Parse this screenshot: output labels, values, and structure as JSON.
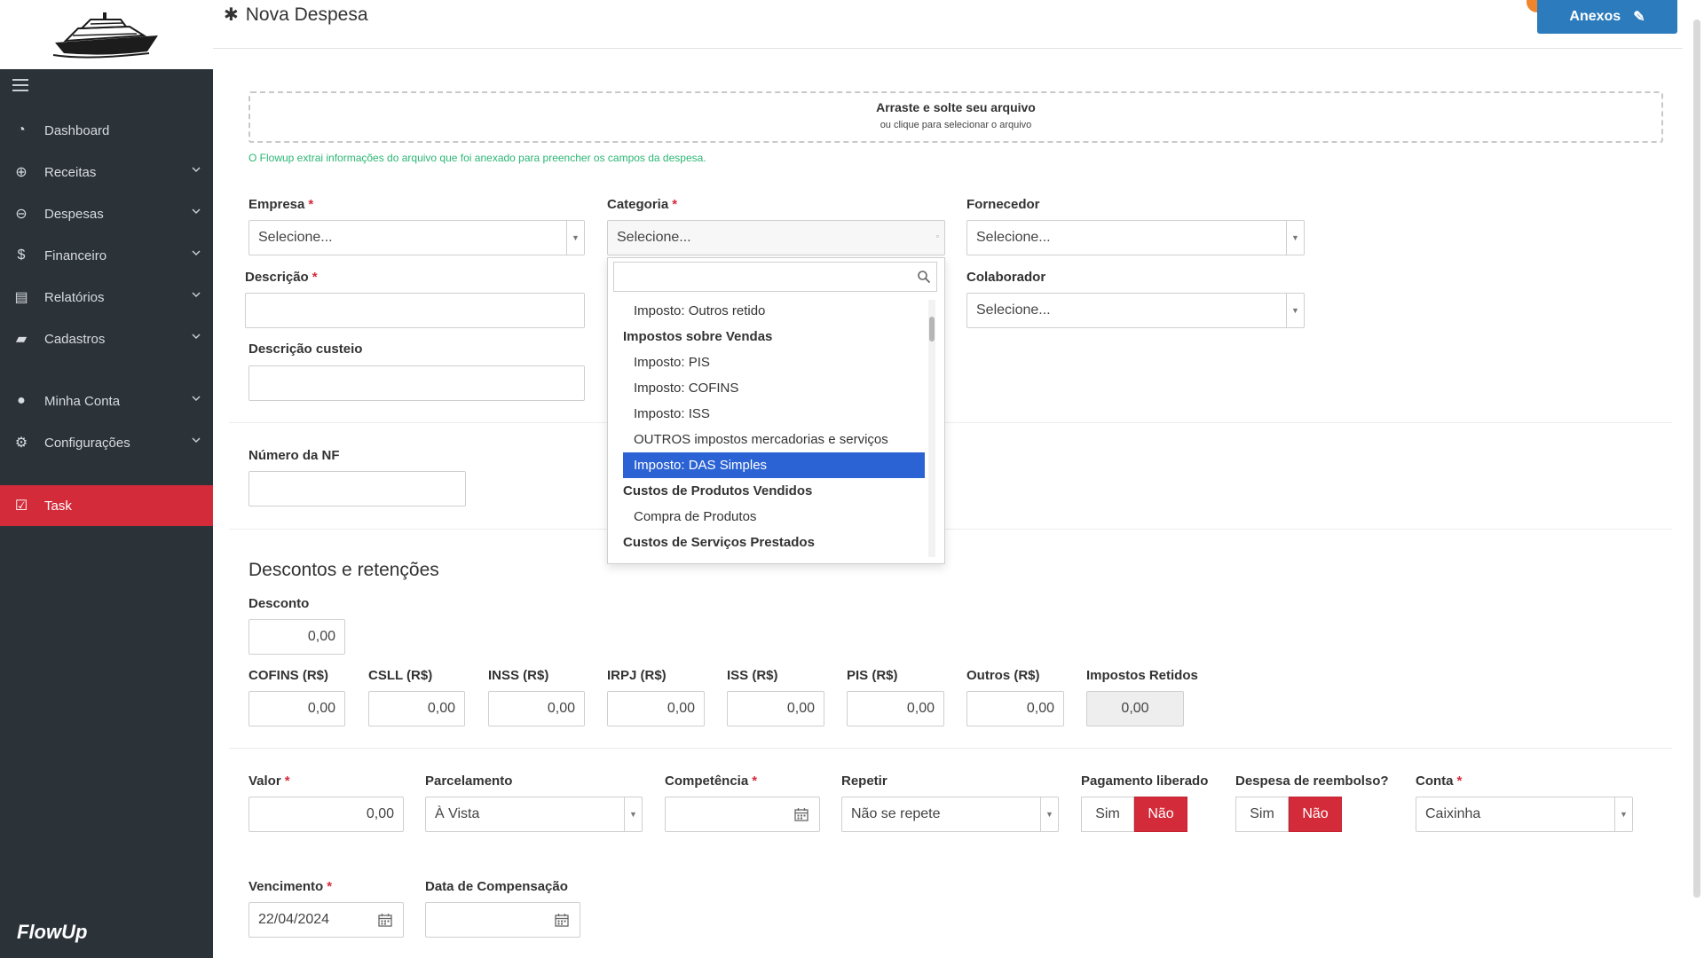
{
  "header": {
    "title": "Nova Despesa",
    "anexos_label": "Anexos"
  },
  "sidebar": {
    "items": [
      {
        "label": "Dashboard",
        "icon": "dashboard-icon"
      },
      {
        "label": "Receitas",
        "icon": "plus-circle-icon"
      },
      {
        "label": "Despesas",
        "icon": "minus-circle-icon"
      },
      {
        "label": "Financeiro",
        "icon": "dollar-icon"
      },
      {
        "label": "Relatórios",
        "icon": "report-icon"
      },
      {
        "label": "Cadastros",
        "icon": "folder-icon"
      },
      {
        "label": "Minha Conta",
        "icon": "user-icon"
      },
      {
        "label": "Configurações",
        "icon": "cogs-icon"
      },
      {
        "label": "Task",
        "icon": "check-square-icon"
      }
    ],
    "brand": "FlowUp"
  },
  "dropzone": {
    "title": "Arraste e solte seu arquivo",
    "subtitle": "ou clique para selecionar o arquivo",
    "note": "O Flowup extrai informações do arquivo que foi anexado para preencher os campos da despesa."
  },
  "form": {
    "empresa": {
      "label": "Empresa",
      "value": "Selecione..."
    },
    "categoria": {
      "label": "Categoria",
      "value": "Selecione..."
    },
    "fornecedor": {
      "label": "Fornecedor",
      "value": "Selecione..."
    },
    "descricao": {
      "label": "Descrição",
      "value": ""
    },
    "colaborador": {
      "label": "Colaborador",
      "value": "Selecione..."
    },
    "descricao_custeio": {
      "label": "Descrição custeio",
      "value": ""
    },
    "numero_nf": {
      "label": "Número da NF",
      "value": ""
    },
    "descontos_title": "Descontos e retenções",
    "desconto": {
      "label": "Desconto",
      "value": "0,00"
    },
    "taxes": [
      {
        "label": "COFINS (R$)",
        "value": "0,00"
      },
      {
        "label": "CSLL (R$)",
        "value": "0,00"
      },
      {
        "label": "INSS (R$)",
        "value": "0,00"
      },
      {
        "label": "IRPJ (R$)",
        "value": "0,00"
      },
      {
        "label": "ISS (R$)",
        "value": "0,00"
      },
      {
        "label": "PIS (R$)",
        "value": "0,00"
      },
      {
        "label": "Outros (R$)",
        "value": "0,00"
      },
      {
        "label": "Impostos Retidos",
        "value": "0,00"
      }
    ],
    "valor": {
      "label": "Valor",
      "value": "0,00"
    },
    "parcelamento": {
      "label": "Parcelamento",
      "value": "À Vista"
    },
    "competencia": {
      "label": "Competência",
      "value": ""
    },
    "repetir": {
      "label": "Repetir",
      "value": "Não se repete"
    },
    "pagamento_liberado": {
      "label": "Pagamento liberado",
      "yes": "Sim",
      "no": "Não"
    },
    "reembolso": {
      "label": "Despesa de reembolso?",
      "yes": "Sim",
      "no": "Não"
    },
    "conta": {
      "label": "Conta",
      "value": "Caixinha"
    },
    "vencimento": {
      "label": "Vencimento",
      "value": "22/04/2024"
    },
    "data_compensacao": {
      "label": "Data de Compensação",
      "value": ""
    }
  },
  "categoria_dropdown": {
    "search_value": "",
    "options": [
      {
        "label": "Imposto: Outros retido",
        "group": false
      },
      {
        "label": "Impostos sobre Vendas",
        "group": true
      },
      {
        "label": "Imposto: PIS",
        "group": false
      },
      {
        "label": "Imposto: COFINS",
        "group": false
      },
      {
        "label": "Imposto: ISS",
        "group": false
      },
      {
        "label": "OUTROS impostos mercadorias e serviços",
        "group": false
      },
      {
        "label": "Imposto: DAS Simples",
        "group": false,
        "highlighted": true
      },
      {
        "label": "Custos de Produtos Vendidos",
        "group": true
      },
      {
        "label": "Compra de Produtos",
        "group": false
      },
      {
        "label": "Custos de Serviços Prestados",
        "group": true
      }
    ]
  },
  "colors": {
    "sidebar_bg": "#2b3238",
    "accent_red": "#d42b3a",
    "primary_blue": "#2c7bbd",
    "highlight_blue": "#2c63d4",
    "note_green": "#2bb673",
    "badge_orange": "#f0852d"
  }
}
